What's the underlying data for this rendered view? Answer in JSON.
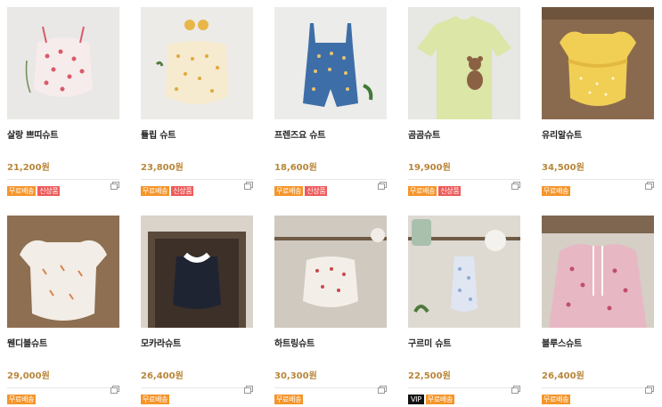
{
  "products": [
    {
      "name": "살랑 쁘띠슈트",
      "price": "21,200원",
      "badges": [
        "무료배송",
        "신상품"
      ]
    },
    {
      "name": "튤립 슈트",
      "price": "23,800원",
      "badges": [
        "무료배송",
        "신상품"
      ]
    },
    {
      "name": "프렌즈요 슈트",
      "price": "18,600원",
      "badges": [
        "무료배송",
        "신상품"
      ]
    },
    {
      "name": "곰곰슈트",
      "price": "19,900원",
      "badges": [
        "무료배송",
        "신상품"
      ]
    },
    {
      "name": "유리알슈트",
      "price": "34,500원",
      "badges": [
        "무료배송"
      ]
    },
    {
      "name": "웬디블슈트",
      "price": "29,000원",
      "badges": [
        "무료배송"
      ]
    },
    {
      "name": "모카라슈트",
      "price": "26,400원",
      "badges": [
        "무료배송"
      ]
    },
    {
      "name": "하트링슈트",
      "price": "30,300원",
      "badges": [
        "무료배송"
      ]
    },
    {
      "name": "구르미 슈트",
      "price": "22,500원",
      "badges": [
        "VIP",
        "무료배송"
      ]
    },
    {
      "name": "블루스슈트",
      "price": "26,400원",
      "badges": [
        "무료배송"
      ]
    }
  ],
  "colors": {
    "price": "#b8863a",
    "free_badge": "#f5952a",
    "new_badge": "#ee5a5a",
    "vip_badge": "#111111"
  },
  "icons": {
    "compare": "window-stack-icon"
  }
}
